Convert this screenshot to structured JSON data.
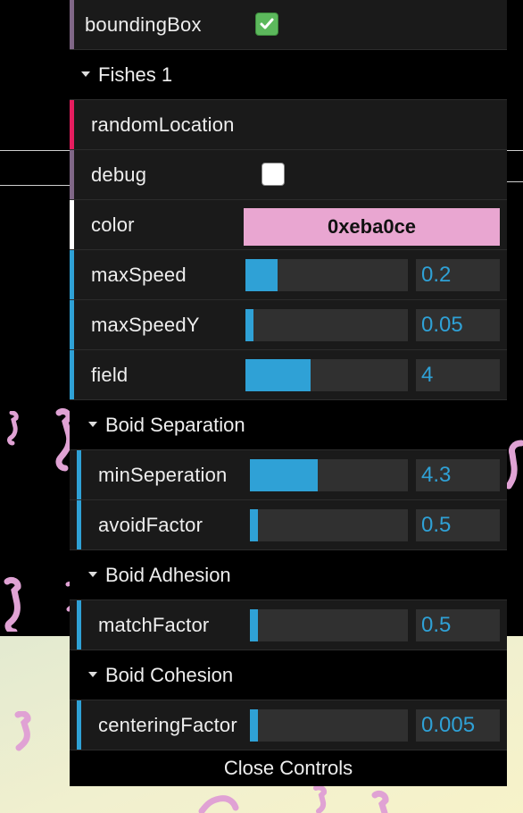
{
  "colors": {
    "panel_bg": "#1a1a1a",
    "slider_accent": "#2fa1d6",
    "checkbox_on": "#5cb85c",
    "swatch": "#e9a6d1",
    "bar_boolean": "#806787",
    "bar_function": "#e61d5f",
    "bar_color": "#ffffff",
    "bar_number": "#2fa1d6",
    "seahorse": "#e0a2d4"
  },
  "controls": {
    "boundingBox": {
      "label": "boundingBox",
      "checked": true,
      "icon": "checkmark-icon"
    },
    "fishes_folder": {
      "label": "Fishes 1",
      "icon": "triangle-down-icon"
    },
    "randomLocation": {
      "label": "randomLocation"
    },
    "debug": {
      "label": "debug",
      "checked": false
    },
    "color": {
      "label": "color",
      "value": "0xeba0ce"
    },
    "maxSpeed": {
      "label": "maxSpeed",
      "value": "0.2",
      "fill": 0.2
    },
    "maxSpeedY": {
      "label": "maxSpeedY",
      "value": "0.05",
      "fill": 0.05
    },
    "field": {
      "label": "field",
      "value": "4",
      "fill": 0.4
    },
    "separation_folder": {
      "label": "Boid Separation",
      "icon": "triangle-down-icon"
    },
    "minSeperation": {
      "label": "minSeperation",
      "value": "4.3",
      "fill": 0.43
    },
    "avoidFactor": {
      "label": "avoidFactor",
      "value": "0.5",
      "fill": 0.05
    },
    "adhesion_folder": {
      "label": "Boid Adhesion",
      "icon": "triangle-down-icon"
    },
    "matchFactor": {
      "label": "matchFactor",
      "value": "0.5",
      "fill": 0.05
    },
    "cohesion_folder": {
      "label": "Boid Cohesion",
      "icon": "triangle-down-icon"
    },
    "centeringFactor": {
      "label": "centeringFactor",
      "value": "0.005",
      "fill": 0.05
    },
    "close_label": "Close Controls"
  }
}
